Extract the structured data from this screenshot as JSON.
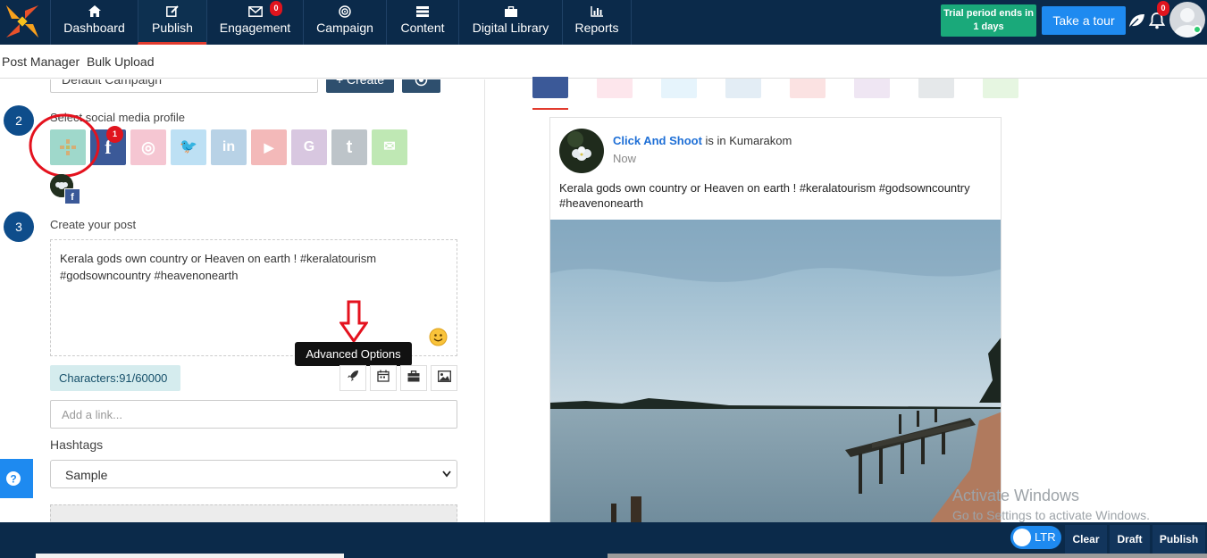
{
  "nav": {
    "items": [
      {
        "label": "Dashboard",
        "icon": "home-icon"
      },
      {
        "label": "Publish",
        "icon": "edit-icon",
        "active": true
      },
      {
        "label": "Engagement",
        "icon": "mail-icon",
        "badge": "0"
      },
      {
        "label": "Campaign",
        "icon": "target-icon"
      },
      {
        "label": "Content",
        "icon": "list-icon"
      },
      {
        "label": "Digital Library",
        "icon": "briefcase-icon"
      },
      {
        "label": "Reports",
        "icon": "bar-chart-icon"
      }
    ]
  },
  "header": {
    "trial_text": "Trial period ends in 1 days",
    "tour_label": "Take a tour",
    "notification_count": "0"
  },
  "subnav": {
    "tabs": [
      "Post Manager",
      "Bulk Upload"
    ]
  },
  "campaign": {
    "selected": "Default Campaign",
    "create_label": "+ Create"
  },
  "steps": {
    "step2_number": "2",
    "step2_label": "Select social media profile",
    "step3_number": "3",
    "step3_label": "Create your post"
  },
  "social_profiles": [
    {
      "name": "company",
      "color": "#9fd8cb"
    },
    {
      "name": "facebook",
      "color": "#3b5998",
      "badge": "1",
      "glyph": "f"
    },
    {
      "name": "instagram",
      "color": "#f5c6d2",
      "glyph": "◎"
    },
    {
      "name": "twitter",
      "color": "#bde0f4",
      "glyph": "🐦"
    },
    {
      "name": "linkedin",
      "color": "#b8d2e6",
      "glyph": "in"
    },
    {
      "name": "youtube",
      "color": "#f3b9b9",
      "glyph": "▶"
    },
    {
      "name": "google-my-business",
      "color": "#d8c7e0",
      "glyph": "G"
    },
    {
      "name": "tumblr",
      "color": "#bdc4c9",
      "glyph": "t"
    },
    {
      "name": "wechat",
      "color": "#bfe8b4",
      "glyph": "✉"
    }
  ],
  "post": {
    "text": "Kerala gods own country or Heaven on earth ! #keralatourism #godsowncountry #heavenonearth",
    "characters": "Characters:91/60000",
    "link_placeholder": "Add a link...",
    "tooltip": "Advanced Options"
  },
  "hashtags": {
    "label": "Hashtags",
    "selected": "Sample"
  },
  "preview": {
    "page_name": "Click And Shoot",
    "location_text": "is in Kumarakom",
    "time": "Now",
    "text": "Kerala gods own country or Heaven on earth ! #keralatourism #godsowncountry #heavenonearth"
  },
  "watermark": {
    "line1": "Activate Windows",
    "line2": "Go to Settings to activate Windows."
  },
  "footer": {
    "ltr_label": "LTR",
    "clear_label": "Clear",
    "draft_label": "Draft",
    "publish_label": "Publish"
  },
  "colors": {
    "navbar": "#0b2a4a",
    "accent_red": "#e23b2e",
    "trial_green": "#1aa97a",
    "tour_blue": "#1e8af0",
    "step_blue": "#0e4d8b",
    "facebook": "#3b5998"
  }
}
